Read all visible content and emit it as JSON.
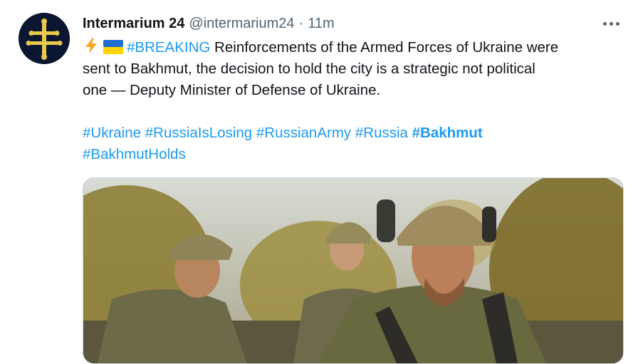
{
  "tweet": {
    "author": {
      "name": "Intermarium 24",
      "handle": "@intermarium24",
      "separator": "·",
      "time": "11m"
    },
    "icons": [
      "lightning-emoji",
      "ukraine-flag-emoji",
      "more-icon"
    ],
    "text": {
      "breaking_tag": "#BREAKING",
      "line1_rest": " Reinforcements of the Armed Forces of Ukraine were",
      "line2": "sent to Bakhmut, the decision to hold the city is a strategic not political",
      "line3": "one — Deputy Minister of Defense of Ukraine."
    },
    "hashtags_line1": [
      "#Ukraine",
      "#RussiaIsLosing",
      "#RussianArmy",
      "#Russia",
      "#Bakhmut"
    ],
    "hashtags_line2": [
      "#BakhmutHolds"
    ],
    "colors": {
      "link": "#1d9bf0",
      "text": "#0f1419",
      "muted": "#536471",
      "avatar_bg": "#0b1630",
      "avatar_cross": "#e8c94a"
    }
  }
}
